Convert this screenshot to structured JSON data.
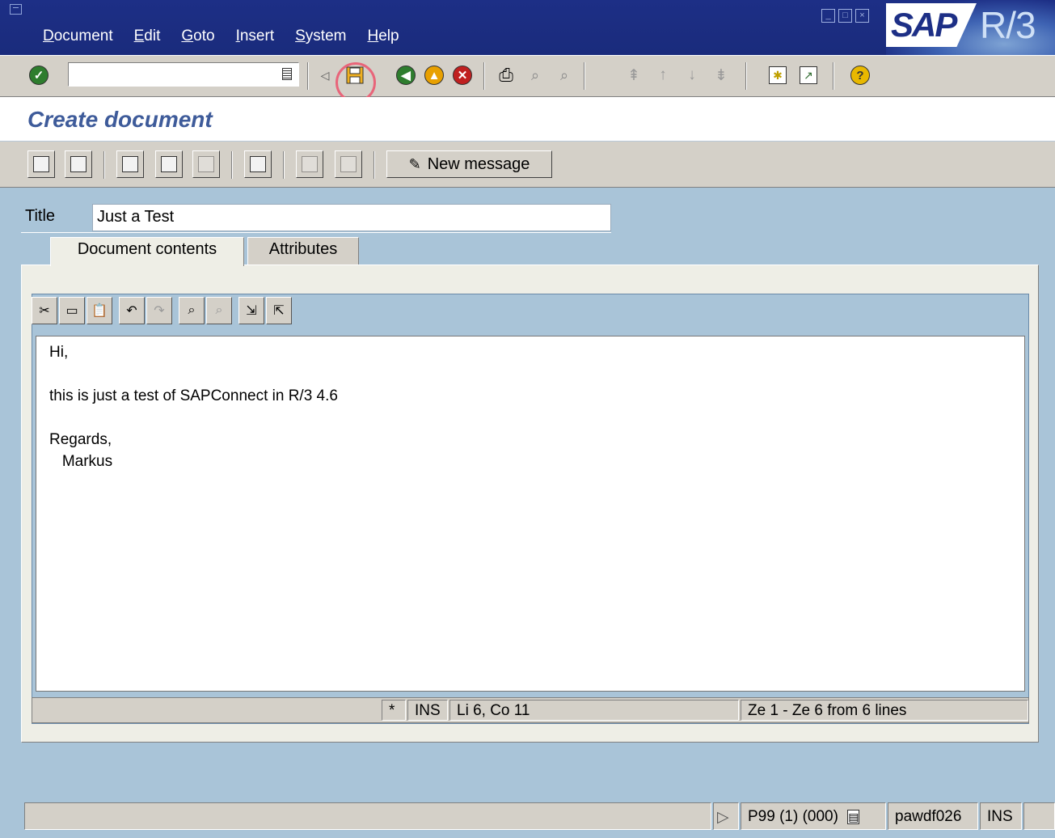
{
  "menu": [
    "Document",
    "Edit",
    "Goto",
    "Insert",
    "System",
    "Help"
  ],
  "logo": {
    "brand": "SAP",
    "product": "R/3"
  },
  "window_controls": [
    "minimize-icon",
    "maximize-icon",
    "close-icon"
  ],
  "toolbar": {
    "command_field_value": "",
    "icons": [
      "enter-icon",
      "save-icon",
      "back-icon",
      "exit-icon",
      "cancel-icon",
      "print-icon",
      "find-icon",
      "find-next-icon",
      "first-page-icon",
      "previous-page-icon",
      "next-page-icon",
      "last-page-icon",
      "create-session-icon",
      "shortcut-icon",
      "help-icon"
    ]
  },
  "page": {
    "title": "Create document"
  },
  "app_toolbar": {
    "new_message_label": "New message"
  },
  "form": {
    "title_label": "Title",
    "title_value": "Just a Test"
  },
  "tabs": [
    {
      "label": "Document contents",
      "active": true
    },
    {
      "label": "Attributes",
      "active": false
    }
  ],
  "editor": {
    "text": "Hi,\n\nthis is just a test of SAPConnect in R/3 4.6\n\nRegards,\n   Markus",
    "status": {
      "modified": "*",
      "mode": "INS",
      "cursor": "Li 6, Co 11",
      "range": "Ze 1 - Ze 6 from 6 lines"
    }
  },
  "statusbar": {
    "system": "P99 (1) (000)",
    "server": "pawdf026",
    "mode": "INS"
  },
  "colors": {
    "menu_bg": "#1d2f86",
    "highlight": "#e8657a",
    "title_text": "#3e5b9a",
    "workspace": "#a9c4d8"
  }
}
